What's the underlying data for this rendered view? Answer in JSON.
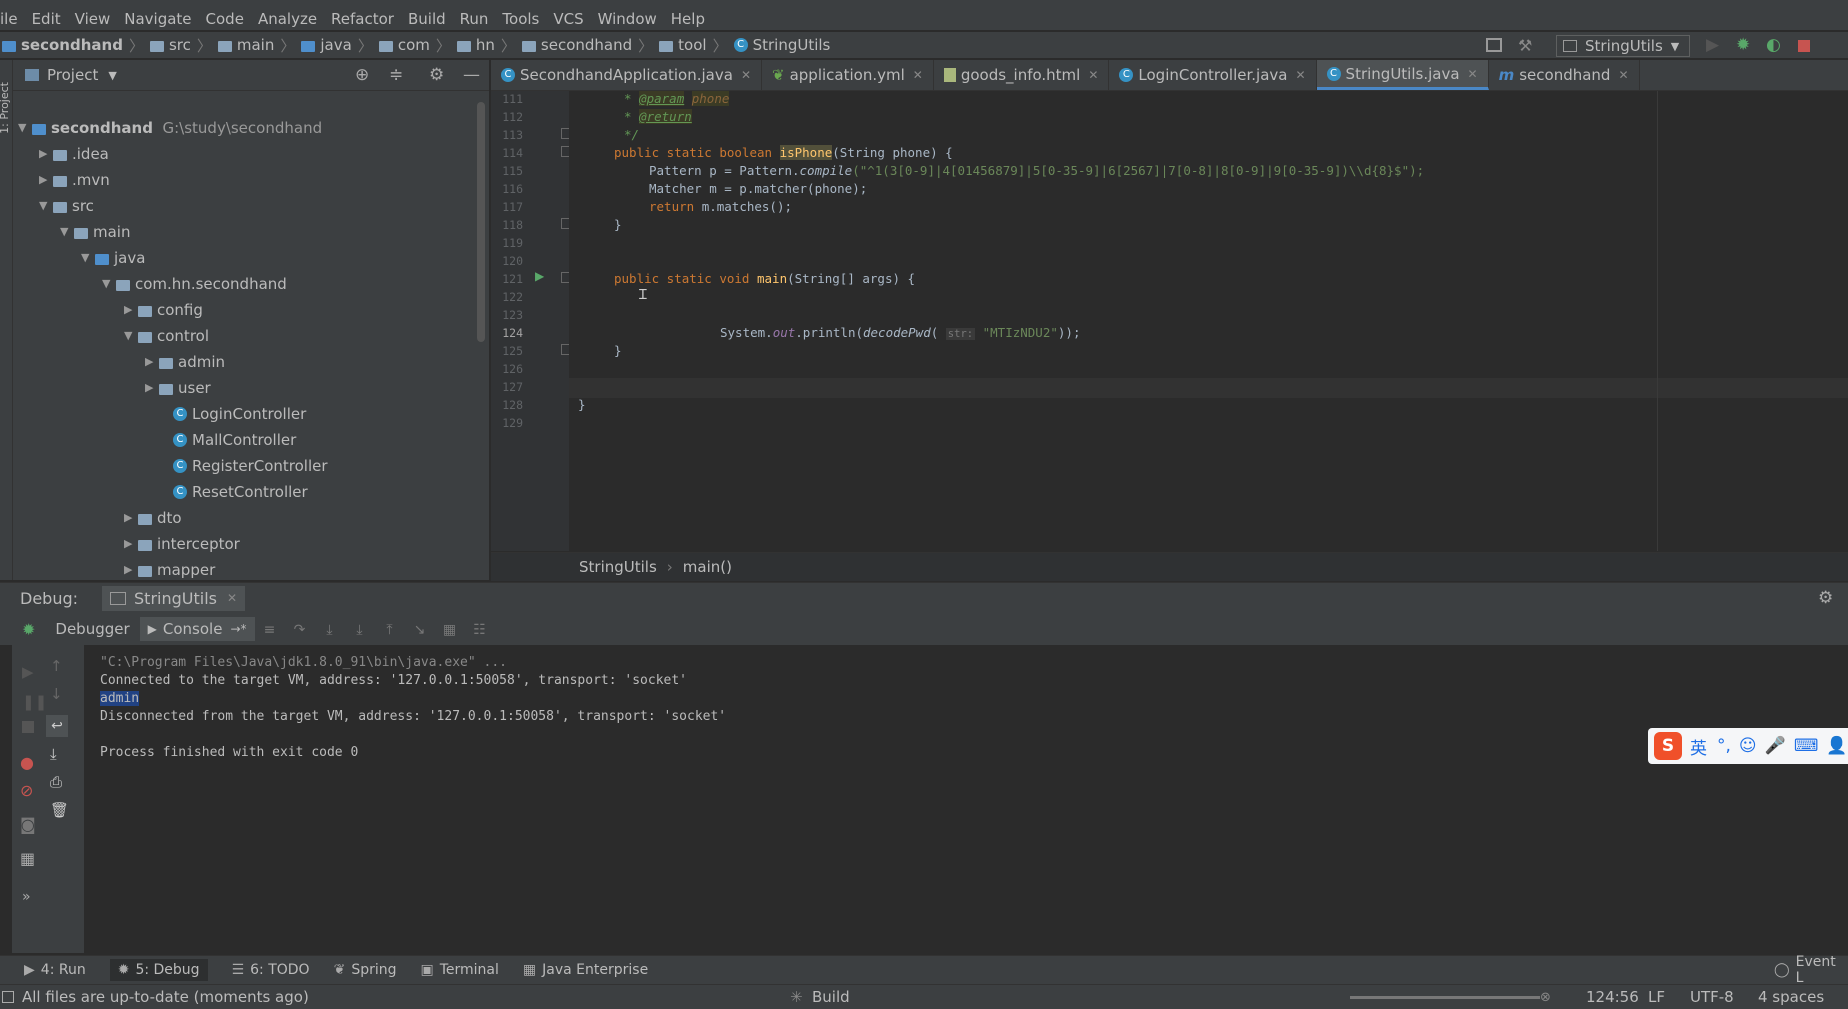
{
  "menu": [
    "ile",
    "Edit",
    "View",
    "Navigate",
    "Code",
    "Analyze",
    "Refactor",
    "Build",
    "Run",
    "Tools",
    "VCS",
    "Window",
    "Help"
  ],
  "breadcrumb": [
    "secondhand",
    "src",
    "main",
    "java",
    "com",
    "hn",
    "secondhand",
    "tool",
    "StringUtils"
  ],
  "run_config": "StringUtils",
  "project": {
    "header": "Project",
    "root_name": "secondhand",
    "root_path": "G:\\study\\secondhand",
    "items": [
      ".idea",
      ".mvn",
      "src",
      "main",
      "java",
      "com.hn.secondhand",
      "config",
      "control",
      "admin",
      "user",
      "LoginController",
      "MallController",
      "RegisterController",
      "ResetController",
      "dto",
      "interceptor",
      "mapper"
    ]
  },
  "tabs": [
    "SecondhandApplication.java",
    "application.yml",
    "goods_info.html",
    "LoginController.java",
    "StringUtils.java",
    "secondhand"
  ],
  "line_numbers": [
    "111",
    "112",
    "113",
    "114",
    "115",
    "116",
    "117",
    "118",
    "119",
    "120",
    "121",
    "122",
    "123",
    "124",
    "125",
    "126",
    "127",
    "128",
    "129"
  ],
  "code": {
    "l111_star": "* ",
    "l111_tag": "@param",
    "l111_arg": "phone",
    "l112_star": "* ",
    "l112_tag": "@return",
    "l113": "*/",
    "l114_kw": "public static boolean ",
    "l114_fn": "isPhone",
    "l114_rest": "(String phone) {",
    "l115_pre": "Pattern p = Pattern.",
    "l115_method": "compile",
    "l115_str": "(\"^1(3[0-9]|4[01456879]|5[0-35-9]|6[2567]|7[0-8]|8[0-9]|9[0-35-9])\\\\d{8}$\");",
    "l116": "Matcher m = p.matcher(phone);",
    "l117_kw": "return ",
    "l117_rest": "m.matches();",
    "l118": "}",
    "l121_kw": "public static void ",
    "l121_fn": "main",
    "l121_rest": "(String[] args) {",
    "l124_a": "System.",
    "l124_out": "out",
    "l124_b": ".println(",
    "l124_fn": "decodePwd",
    "l124_c": "( ",
    "l124_hint": "str:",
    "l124_str": " \"MTIzNDU2\"",
    "l124_d": "));",
    "l125": "}",
    "l128": "}"
  },
  "editor_breadcrumb": [
    "StringUtils",
    "main()"
  ],
  "debug": {
    "label": "Debug:",
    "session_tab": "StringUtils",
    "debugger_tab": "Debugger",
    "console_tab": "Console"
  },
  "console_lines": [
    "\"C:\\Program Files\\Java\\jdk1.8.0_91\\bin\\java.exe\" ...",
    "Connected to the target VM, address: '127.0.0.1:50058', transport: 'socket'",
    "admin",
    "Disconnected from the target VM, address: '127.0.0.1:50058', transport: 'socket'",
    "",
    "Process finished with exit code 0"
  ],
  "bottom_tabs": [
    "4: Run",
    "5: Debug",
    "6: TODO",
    "Spring",
    "Terminal",
    "Java Enterprise",
    "Event L"
  ],
  "status": {
    "message": "All files are up-to-date (moments ago)",
    "build": "Build",
    "position": "124:56",
    "line_sep": "LF",
    "encoding": "UTF-8",
    "indent": "4 spaces"
  },
  "ime": {
    "logo": "S",
    "mode": "英"
  },
  "left_strip_label": "1: Project",
  "colors": {
    "accent": "#4a88c7",
    "keyword": "#cc7832",
    "string": "#6a8759",
    "function": "#ffc66d",
    "comment": "#629755",
    "bg": "#2b2b2b",
    "panel": "#3c3f41"
  }
}
